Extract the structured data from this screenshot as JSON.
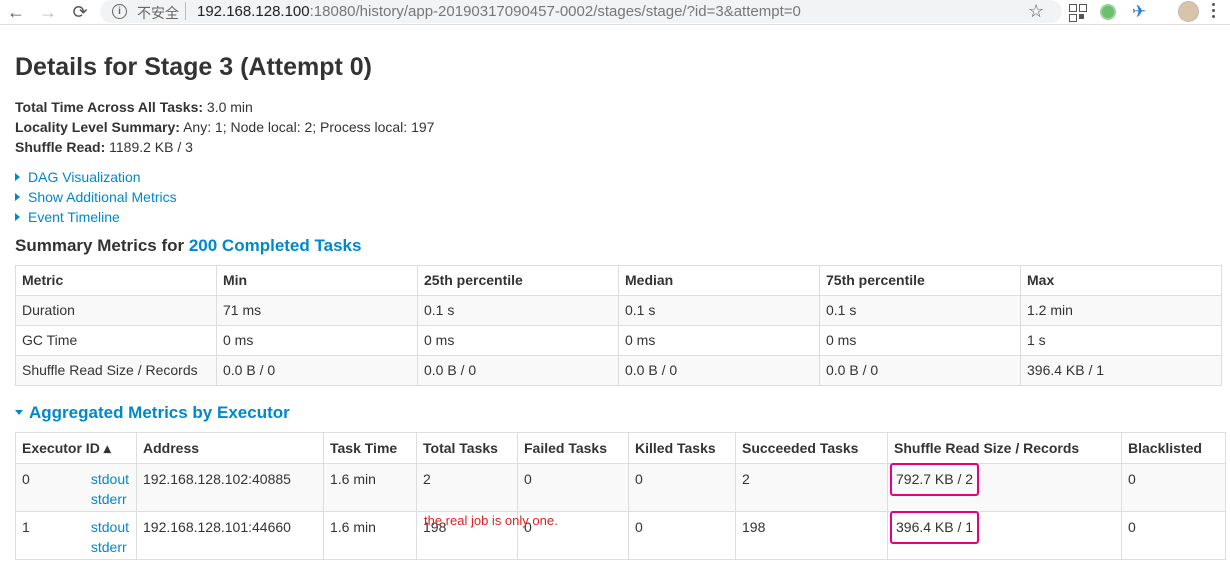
{
  "browser": {
    "back_glyph": "←",
    "forward_glyph": "→",
    "reload_glyph": "⟳",
    "security_label": "不安全",
    "url_host": "192.168.128.100",
    "url_rest": ":18080/history/app-20190317090457-0002/stages/stage/?id=3&attempt=0",
    "star_glyph": "☆",
    "bird_glyph": "✈"
  },
  "page": {
    "title": "Details for Stage 3 (Attempt 0)",
    "summary": [
      {
        "label": "Total Time Across All Tasks:",
        "value": " 3.0 min"
      },
      {
        "label": "Locality Level Summary:",
        "value": " Any: 1; Node local: 2; Process local: 197"
      },
      {
        "label": "Shuffle Read:",
        "value": " 1189.2 KB / 3"
      }
    ],
    "toggles": [
      "DAG Visualization",
      "Show Additional Metrics",
      "Event Timeline"
    ],
    "summary_metrics_prefix": "Summary Metrics for ",
    "summary_metrics_link": "200 Completed Tasks",
    "aggregated_title": "Aggregated Metrics by Executor",
    "note": "the real job is only one."
  },
  "metrics_table": {
    "headers": [
      "Metric",
      "Min",
      "25th percentile",
      "Median",
      "75th percentile",
      "Max"
    ],
    "rows": [
      [
        "Duration",
        "71 ms",
        "0.1 s",
        "0.1 s",
        "0.1 s",
        "1.2 min"
      ],
      [
        "GC Time",
        "0 ms",
        "0 ms",
        "0 ms",
        "0 ms",
        "1 s"
      ],
      [
        "Shuffle Read Size / Records",
        "0.0 B / 0",
        "0.0 B / 0",
        "0.0 B / 0",
        "0.0 B / 0",
        "396.4 KB / 1"
      ]
    ]
  },
  "executor_table": {
    "headers": [
      "Executor ID ▴",
      "Address",
      "Task Time",
      "Total Tasks",
      "Failed Tasks",
      "Killed Tasks",
      "Succeeded Tasks",
      "Shuffle Read Size / Records",
      "Blacklisted"
    ],
    "rows": [
      {
        "id": "0",
        "stdout": "stdout",
        "stderr": "stderr",
        "address": "192.168.128.102:40885",
        "task_time": "1.6 min",
        "total": "2",
        "failed": "0",
        "killed": "0",
        "succeeded": "2",
        "shuffle": "792.7 KB / 2",
        "blacklisted": "0"
      },
      {
        "id": "1",
        "stdout": "stdout",
        "stderr": "stderr",
        "address": "192.168.128.101:44660",
        "task_time": "1.6 min",
        "total": "198",
        "failed": "0",
        "killed": "0",
        "succeeded": "198",
        "shuffle": "396.4 KB / 1",
        "blacklisted": "0"
      }
    ]
  },
  "colors": {
    "link": "#0088cc",
    "highlight": "#e6007e",
    "note": "#e02020"
  }
}
